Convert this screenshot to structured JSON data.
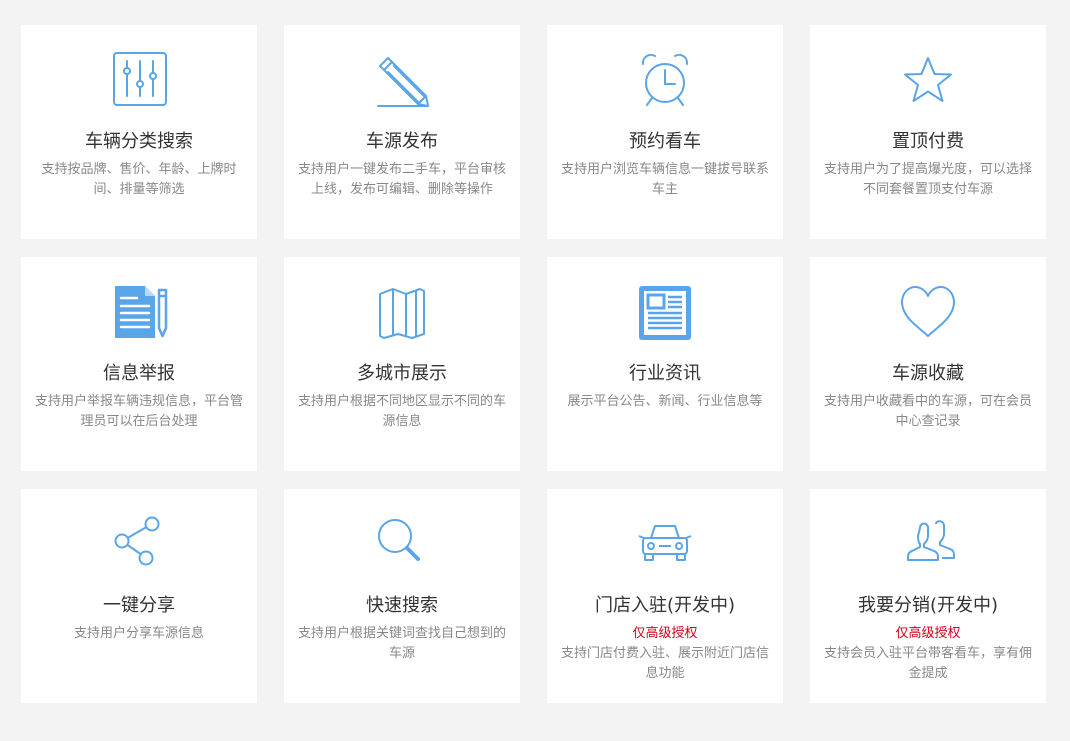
{
  "colors": {
    "accent": "#5aa4e8",
    "background": "#f3f3f3",
    "card": "#ffffff",
    "title": "#333333",
    "desc": "#888888",
    "badge": "#d0021b"
  },
  "features": [
    {
      "icon": "sliders-icon",
      "title": "车辆分类搜索",
      "badge": "",
      "desc": "支持按品牌、售价、年龄、上牌时间、排量等筛选"
    },
    {
      "icon": "pencil-icon",
      "title": "车源发布",
      "badge": "",
      "desc": "支持用户一键发布二手车，平台审核上线，发布可编辑、删除等操作"
    },
    {
      "icon": "alarm-clock-icon",
      "title": "预约看车",
      "badge": "",
      "desc": "支持用户浏览车辆信息一键拔号联系车主"
    },
    {
      "icon": "star-icon",
      "title": "置顶付费",
      "badge": "",
      "desc": "支持用户为了提高爆光度，可以选择不同套餐置顶支付车源"
    },
    {
      "icon": "document-pen-icon",
      "title": "信息举报",
      "badge": "",
      "desc": "支持用户举报车辆违规信息，平台管理员可以在后台处理"
    },
    {
      "icon": "map-icon",
      "title": "多城市展示",
      "badge": "",
      "desc": "支持用户根据不同地区显示不同的车源信息"
    },
    {
      "icon": "newspaper-icon",
      "title": "行业资讯",
      "badge": "",
      "desc": "展示平台公告、新闻、行业信息等"
    },
    {
      "icon": "heart-icon",
      "title": "车源收藏",
      "badge": "",
      "desc": "支持用户收藏看中的车源，可在会员中心查记录"
    },
    {
      "icon": "share-icon",
      "title": "一键分享",
      "badge": "",
      "desc": "支持用户分享车源信息"
    },
    {
      "icon": "search-icon",
      "title": "快速搜索",
      "badge": "",
      "desc": "支持用户根据关键词查找自己想到的车源"
    },
    {
      "icon": "car-icon",
      "title": "门店入驻(开发中)",
      "badge": "仅高级授权",
      "desc": "支持门店付费入驻、展示附近门店信息功能"
    },
    {
      "icon": "users-icon",
      "title": "我要分销(开发中)",
      "badge": "仅高级授权",
      "desc": "支持会员入驻平台带客看车，享有佣金提成"
    }
  ]
}
